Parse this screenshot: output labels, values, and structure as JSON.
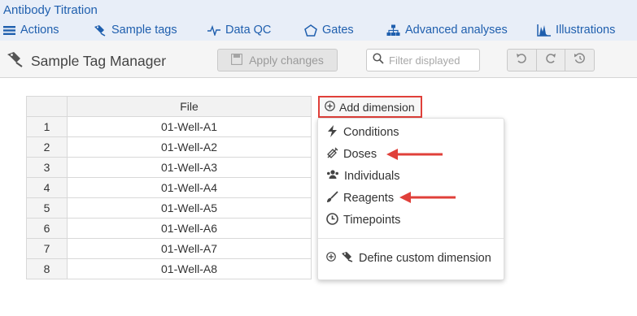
{
  "app": {
    "title": "Antibody Titration"
  },
  "nav": {
    "items": [
      {
        "label": "Actions",
        "icon": "hamburger-icon"
      },
      {
        "label": "Sample tags",
        "icon": "tag-icon"
      },
      {
        "label": "Data QC",
        "icon": "pulse-icon"
      },
      {
        "label": "Gates",
        "icon": "pentagon-icon"
      },
      {
        "label": "Advanced analyses",
        "icon": "hierarchy-icon"
      },
      {
        "label": "Illustrations",
        "icon": "histogram-icon"
      }
    ]
  },
  "toolbar": {
    "title": "Sample Tag Manager",
    "apply_label": "Apply changes",
    "filter_placeholder": "Filter displayed",
    "buttons": [
      "undo-icon",
      "redo-icon",
      "history-icon"
    ]
  },
  "table": {
    "column_header": "File",
    "rows": [
      {
        "index": "1",
        "file": "01-Well-A1"
      },
      {
        "index": "2",
        "file": "01-Well-A2"
      },
      {
        "index": "3",
        "file": "01-Well-A3"
      },
      {
        "index": "4",
        "file": "01-Well-A4"
      },
      {
        "index": "5",
        "file": "01-Well-A5"
      },
      {
        "index": "6",
        "file": "01-Well-A6"
      },
      {
        "index": "7",
        "file": "01-Well-A7"
      },
      {
        "index": "8",
        "file": "01-Well-A8"
      }
    ]
  },
  "add_dimension": {
    "label": "Add dimension",
    "menu": [
      {
        "label": "Conditions",
        "icon": "lightning-icon"
      },
      {
        "label": "Doses",
        "icon": "syringe-icon"
      },
      {
        "label": "Individuals",
        "icon": "people-icon"
      },
      {
        "label": "Reagents",
        "icon": "brush-icon"
      },
      {
        "label": "Timepoints",
        "icon": "clock-icon"
      }
    ],
    "custom_label": "Define custom dimension"
  },
  "colors": {
    "accent": "#1f5fae",
    "highlight": "#e0403a",
    "nav_bg": "#e8eef8"
  }
}
